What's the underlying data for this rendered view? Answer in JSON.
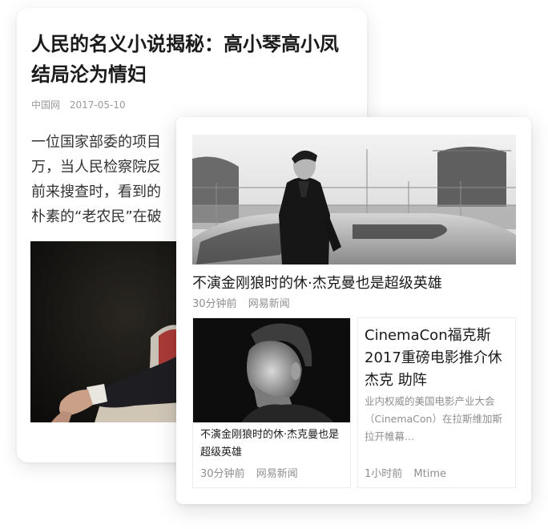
{
  "back_article": {
    "title": "人民的名义小说揭秘：高小琴高小凤结局沦为情妇",
    "source": "中国网",
    "date": "2017-05-10",
    "body_lines": [
      "一位国家部委的项目",
      "万，当人民检察院反",
      "前来搜查时，看到的",
      "朴素的“老农民”在破"
    ]
  },
  "front_card": {
    "hero": {
      "title": "不演金刚狼时的休·杰克曼也是超级英雄",
      "time": "30分钟前",
      "source": "网易新闻"
    },
    "left_item": {
      "title": "不演金刚狼时的休·杰克曼也是超级英雄",
      "time": "30分钟前",
      "source": "网易新闻"
    },
    "right_item": {
      "title": "CinemaCon福克斯2017重磅电影推介休杰克 助阵",
      "summary": "业内权威的美国电影产业大会（CinemaCon）在拉斯维加斯拉开帷幕...",
      "time": "1小时前",
      "source": "Mtime"
    }
  }
}
